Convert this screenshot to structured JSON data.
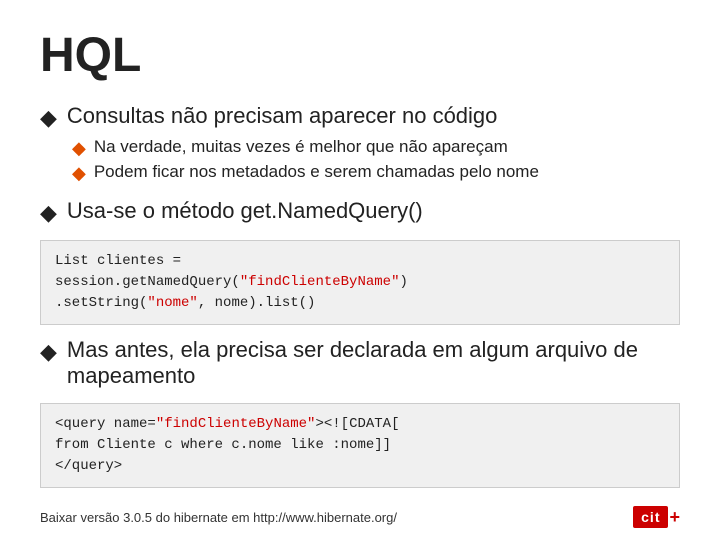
{
  "title": "HQL",
  "bullets": [
    {
      "id": "bullet1",
      "main": "Consultas não precisam aparecer no código",
      "subs": [
        "Na verdade, muitas vezes é melhor que não apareçam",
        "Podem ficar nos metadados e serem chamadas pelo nome"
      ]
    },
    {
      "id": "bullet2",
      "main": "Usa-se o método get.NamedQuery()",
      "subs": []
    },
    {
      "id": "bullet3",
      "main": "Mas antes, ela precisa ser declarada em algum arquivo de mapeamento",
      "subs": []
    }
  ],
  "code_block1": {
    "line1": "List clientes =",
    "line2_prefix": "        session.getNamedQuery(",
    "line2_highlight": "\"findClienteByName\"",
    "line2_suffix": ")",
    "line3_prefix": "        .setString(",
    "line3_str1": "\"nome\"",
    "line3_middle": ", nome).list()"
  },
  "code_block2": {
    "line1_prefix": "<query name=",
    "line1_highlight": "\"findClienteByName\"",
    "line1_suffix": "><![CDATA[",
    "line2": "        from Cliente c where c.nome like :nome]]",
    "line3": "</query>"
  },
  "footer": {
    "text": "Baixar versão 3.0.5 do hibernate em http://www.hibernate.org/",
    "logo": "cit"
  }
}
